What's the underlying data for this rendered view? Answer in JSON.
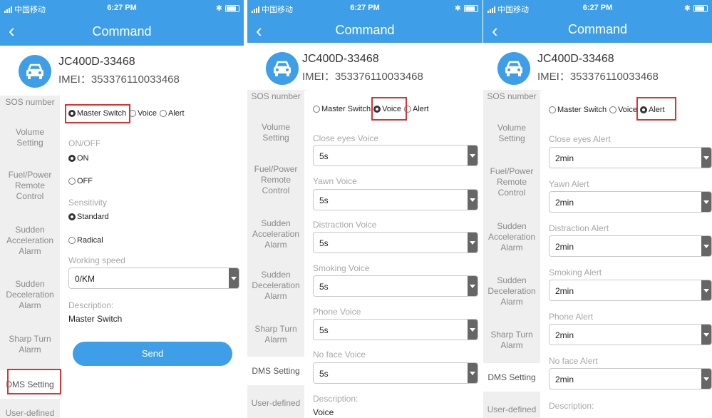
{
  "statusbar": {
    "carrier": "中国移动",
    "time": "6:27 PM",
    "bluetooth": "✱"
  },
  "navbar": {
    "back_icon": "‹",
    "title": "Command"
  },
  "device": {
    "name": "JC400D-33468",
    "imei": "IMEI：353376110033468",
    "icon": "car-icon"
  },
  "sidebar": {
    "sos": "SOS number",
    "volume": "Volume Setting",
    "fuel": "Fuel/Power Remote Control",
    "accel": "Sudden Acceleration Alarm",
    "decel": "Sudden Deceleration Alarm",
    "sharp": "Sharp Turn Alarm",
    "dms": "DMS Setting",
    "user": "User-defined"
  },
  "mode_options": {
    "master": "Master Switch",
    "voice": "Voice",
    "alert": "Alert"
  },
  "screen1": {
    "onoff_label": "ON/OFF",
    "on_label": "ON",
    "off_label": "OFF",
    "sensitivity_label": "Sensitivity",
    "standard_label": "Standard",
    "radical_label": "Radical",
    "speed_label": "Working speed",
    "speed_value": "0/KM",
    "description_label": "Description:",
    "description_value": "Master Switch",
    "send_label": "Send"
  },
  "screen2": {
    "close_eyes_label": "Close eyes Voice",
    "close_eyes_value": "5s",
    "yawn_label": "Yawn Voice",
    "yawn_value": "5s",
    "distraction_label": "Distraction Voice",
    "distraction_value": "5s",
    "smoking_label": "Smoking Voice",
    "smoking_value": "5s",
    "phone_label": "Phone Voice",
    "phone_value": "5s",
    "noface_label": "No face Voice",
    "noface_value": "5s",
    "description_label": "Description:",
    "description_value": "Voice"
  },
  "screen3": {
    "close_eyes_label": "Close eyes Alert",
    "close_eyes_value": "2min",
    "yawn_label": "Yawn Alert",
    "yawn_value": "2min",
    "distraction_label": "Distraction Alert",
    "distraction_value": "2min",
    "smoking_label": "Smoking Alert",
    "smoking_value": "2min",
    "phone_label": "Phone Alert",
    "phone_value": "2min",
    "noface_label": "No face Alert",
    "noface_value": "2min",
    "description_label": "Description:"
  },
  "colors": {
    "header_blue": "#3e9ee8",
    "highlight_red": "#e03030"
  }
}
